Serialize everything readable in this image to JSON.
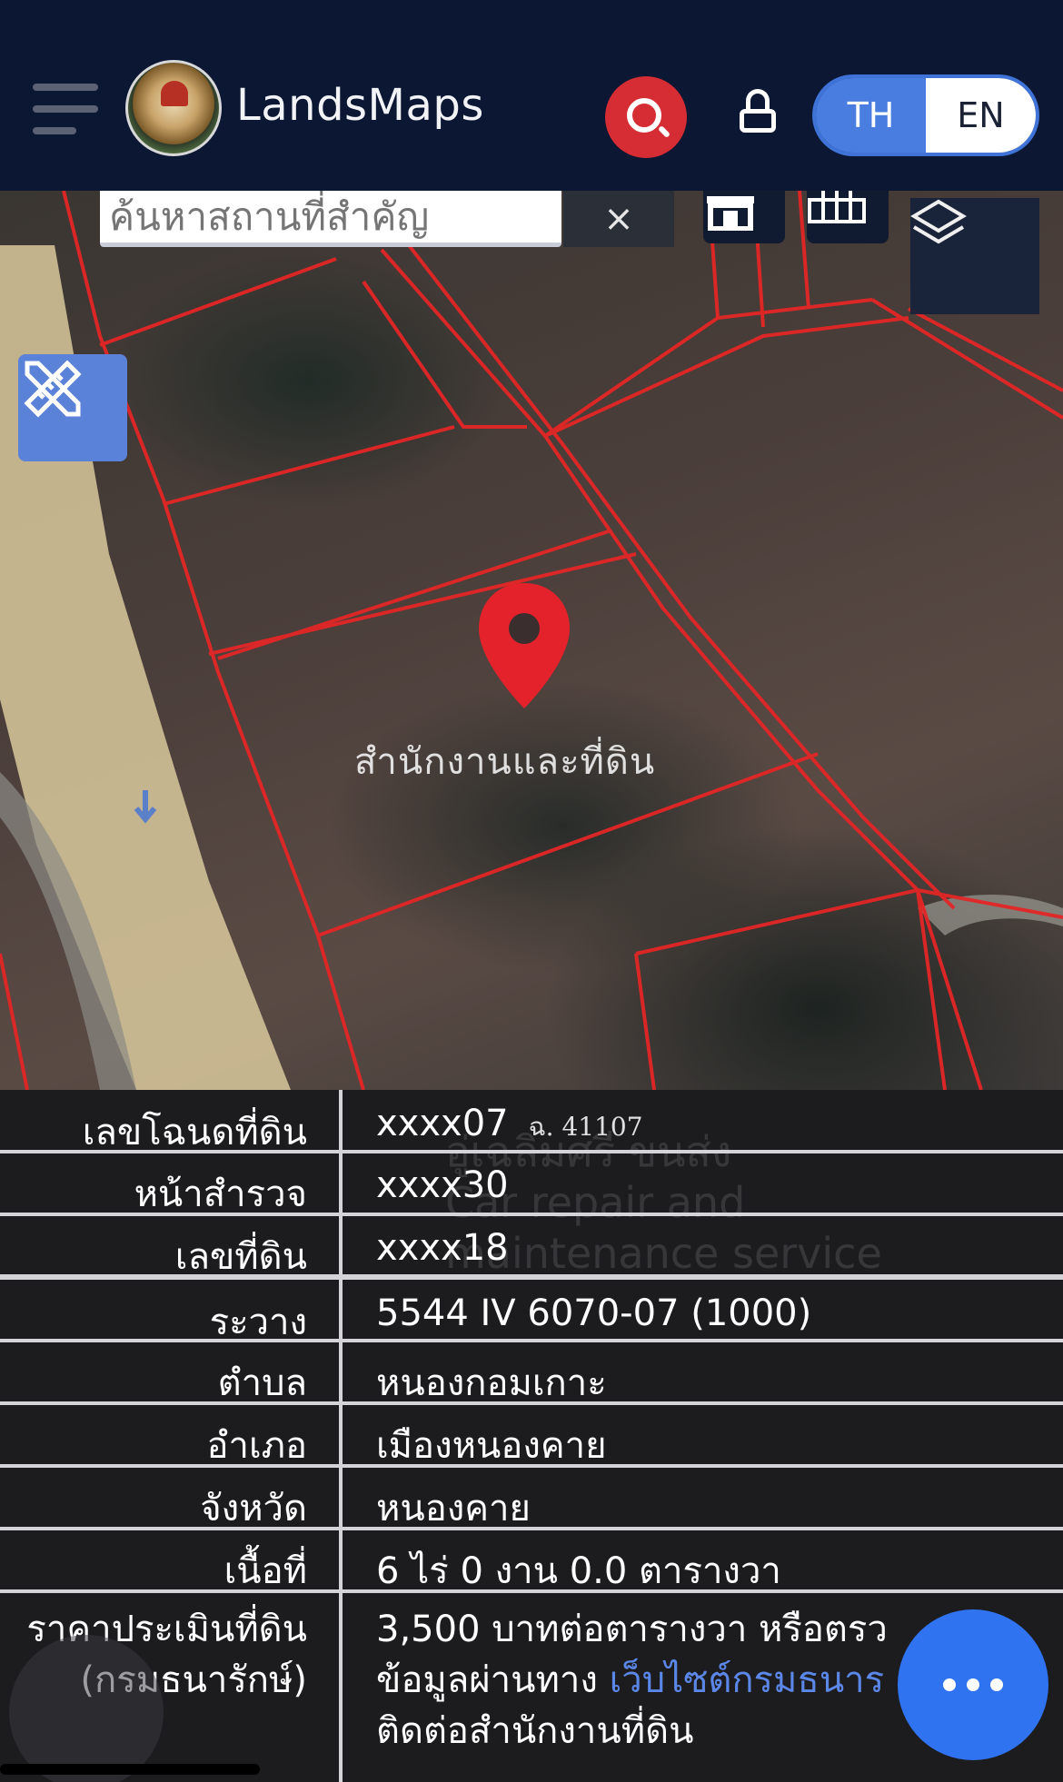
{
  "header": {
    "app_title": "LandsMaps",
    "lang_th": "TH",
    "lang_en": "EN",
    "active_lang": "TH"
  },
  "map": {
    "search_placeholder": "ค้นหาสถานที่สำคัญ",
    "clear_symbol": "×",
    "place_label": "สำนักงานและที่ดิน"
  },
  "parcel": {
    "rows": [
      {
        "label": "เลขโฉนดที่ดิน",
        "value": "xxxx07",
        "stamp": "ฉ. 41107"
      },
      {
        "label": "หน้าสำรวจ",
        "value": "xxxx30"
      },
      {
        "label": "เลขที่ดิน",
        "value": "xxxx18"
      },
      {
        "label": "ระวาง",
        "value": "5544 IV 6070-07 (1000)"
      },
      {
        "label": "ตำบล",
        "value": "หนองกอมเกาะ"
      },
      {
        "label": "อำเภอ",
        "value": "เมืองหนองคาย"
      },
      {
        "label": "จังหวัด",
        "value": "หนองคาย"
      },
      {
        "label": "เนื้อที่",
        "value": "6 ไร่ 0 งาน 0.0 ตารางวา"
      }
    ],
    "price": {
      "label_line1": "ราคาประเมินที่ดิน",
      "label_line2": "(กรมธนารักษ์)",
      "value_line1": "3,500 บาทต่อตารางวา หรือตรว",
      "value_line2_prefix": "ข้อมูลผ่านทาง ",
      "value_line2_link": "เว็บไซต์กรมธนาร",
      "value_line3": "ติดต่อสำนักงานที่ดิน"
    },
    "background_watermark": [
      "อู่เฉลิมศรี ขนส่ง",
      "Car repair and",
      "maintenance service"
    ]
  },
  "colors": {
    "header_bg": "#0b1733",
    "search_red": "#d62c33",
    "accent_blue": "#4a7de0",
    "parcel_line": "#e02424",
    "fab_blue": "#2f73f0"
  }
}
